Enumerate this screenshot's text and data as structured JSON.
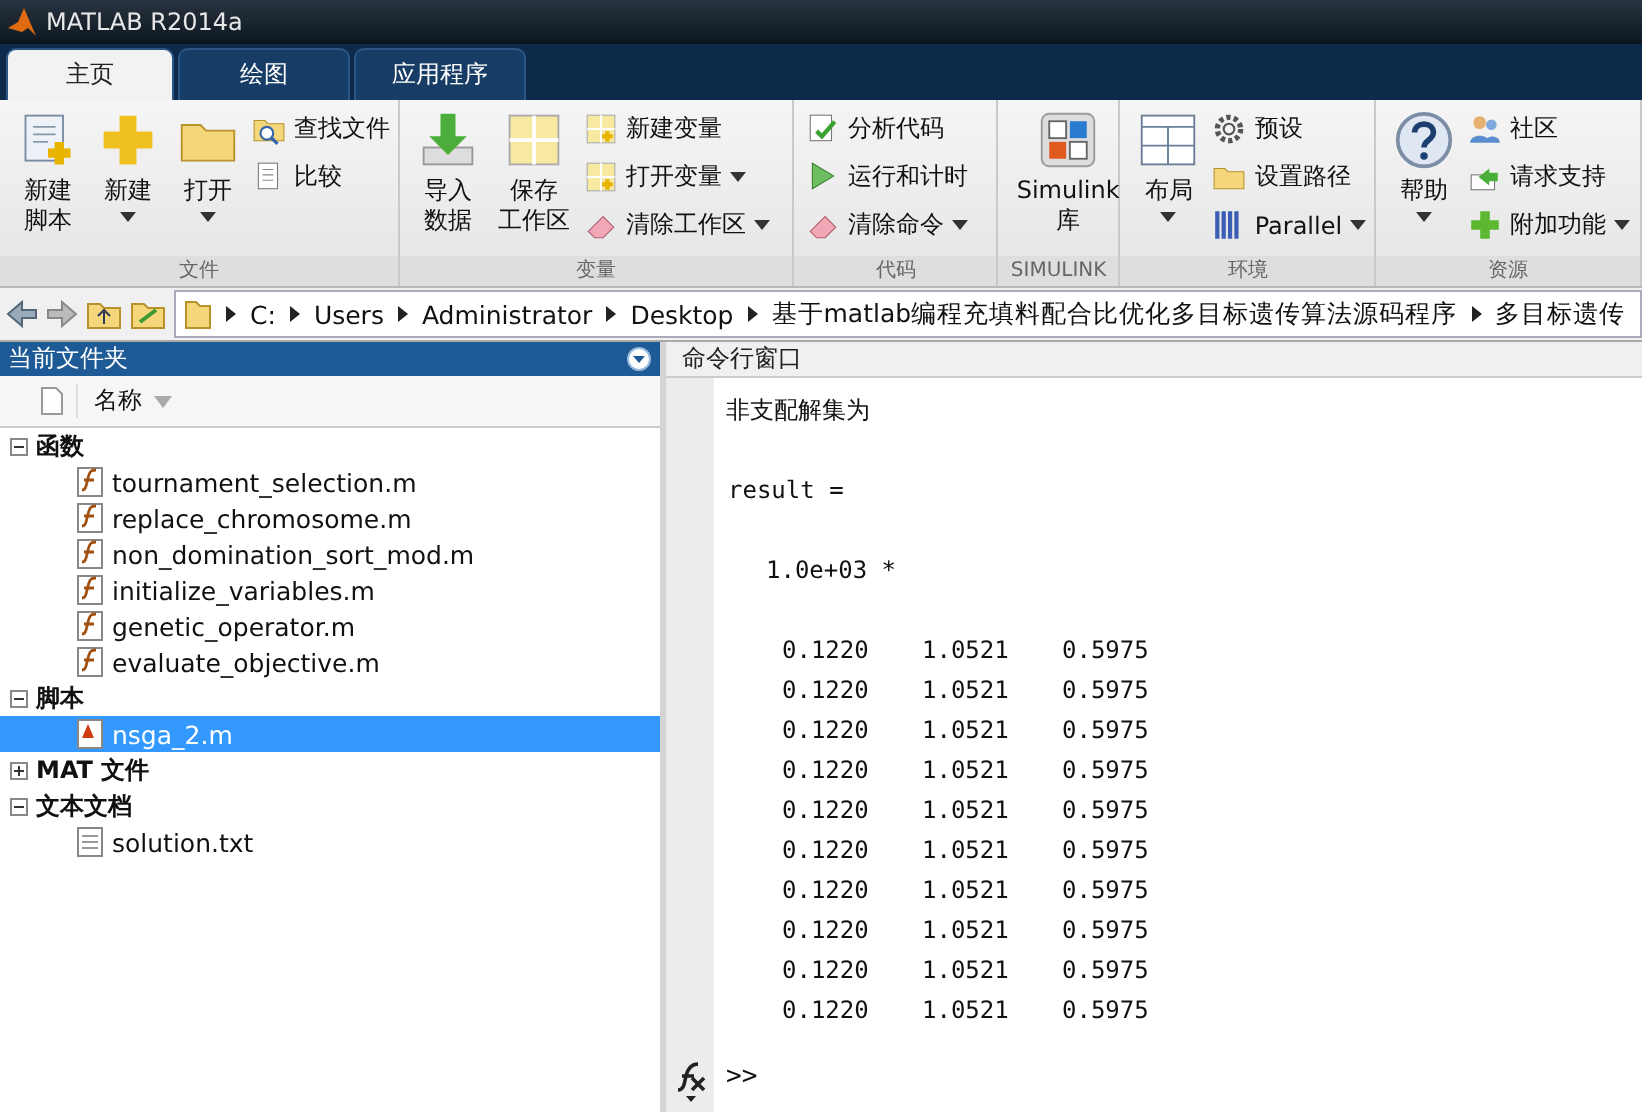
{
  "window": {
    "title": "MATLAB R2014a"
  },
  "tabs": [
    {
      "label": "主页",
      "selected": true
    },
    {
      "label": "绘图",
      "selected": false
    },
    {
      "label": "应用程序",
      "selected": false
    }
  ],
  "ribbon": [
    {
      "label": "文件",
      "items": [
        {
          "kind": "large",
          "lines": [
            "新建",
            "脚本"
          ],
          "dropdown": false
        },
        {
          "kind": "large",
          "lines": [
            "新建"
          ],
          "dropdown": true
        },
        {
          "kind": "large",
          "lines": [
            "打开"
          ],
          "dropdown": true
        },
        {
          "kind": "small",
          "lines": [
            "查找文件"
          ],
          "dropdown": false
        },
        {
          "kind": "small",
          "lines": [
            "比较"
          ],
          "dropdown": false
        }
      ]
    },
    {
      "label": "变量",
      "items": [
        {
          "kind": "large",
          "lines": [
            "导入",
            "数据"
          ],
          "dropdown": false
        },
        {
          "kind": "large",
          "lines": [
            "保存",
            "工作区"
          ],
          "dropdown": false
        },
        {
          "kind": "small",
          "lines": [
            "新建变量"
          ],
          "dropdown": false
        },
        {
          "kind": "small",
          "lines": [
            "打开变量"
          ],
          "dropdown": true
        },
        {
          "kind": "small",
          "lines": [
            "清除工作区"
          ],
          "dropdown": true
        }
      ]
    },
    {
      "label": "代码",
      "items": [
        {
          "kind": "small",
          "lines": [
            "分析代码"
          ],
          "dropdown": false
        },
        {
          "kind": "small",
          "lines": [
            "运行和计时"
          ],
          "dropdown": false
        },
        {
          "kind": "small",
          "lines": [
            "清除命令"
          ],
          "dropdown": true
        }
      ]
    },
    {
      "label": "SIMULINK",
      "items": [
        {
          "kind": "large",
          "lines": [
            "Simulink",
            "库"
          ],
          "dropdown": false
        }
      ]
    },
    {
      "label": "环境",
      "items": [
        {
          "kind": "large",
          "lines": [
            "布局"
          ],
          "dropdown": true
        },
        {
          "kind": "small",
          "lines": [
            "预设"
          ],
          "dropdown": false
        },
        {
          "kind": "small",
          "lines": [
            "设置路径"
          ],
          "dropdown": false
        },
        {
          "kind": "small",
          "lines": [
            "Parallel"
          ],
          "dropdown": true
        }
      ]
    },
    {
      "label": "资源",
      "items": [
        {
          "kind": "large",
          "lines": [
            "帮助"
          ],
          "dropdown": true
        },
        {
          "kind": "small",
          "lines": [
            "社区"
          ],
          "dropdown": false
        },
        {
          "kind": "small",
          "lines": [
            "请求支持"
          ],
          "dropdown": false
        },
        {
          "kind": "small",
          "lines": [
            "附加功能"
          ],
          "dropdown": true
        }
      ]
    }
  ],
  "address_bar": {
    "path": [
      "C:",
      "Users",
      "Administrator",
      "Desktop",
      "基于matlab编程充填料配合比优化多目标遗传算法源码程序",
      "多目标遗传"
    ]
  },
  "current_folder": {
    "title": "当前文件夹",
    "column": "名称",
    "groups": [
      {
        "label": "函数",
        "expanded": true,
        "children": [
          {
            "name": "tournament_selection.m",
            "kind": "function",
            "selected": false
          },
          {
            "name": "replace_chromosome.m",
            "kind": "function",
            "selected": false
          },
          {
            "name": "non_domination_sort_mod.m",
            "kind": "function",
            "selected": false
          },
          {
            "name": "initialize_variables.m",
            "kind": "function",
            "selected": false
          },
          {
            "name": "genetic_operator.m",
            "kind": "function",
            "selected": false
          },
          {
            "name": "evaluate_objective.m",
            "kind": "function",
            "selected": false
          }
        ]
      },
      {
        "label": "脚本",
        "expanded": true,
        "children": [
          {
            "name": "nsga_2.m",
            "kind": "script",
            "selected": true
          }
        ]
      },
      {
        "label": "MAT 文件",
        "expanded": false
      },
      {
        "label": "文本文档",
        "expanded": true,
        "children": [
          {
            "name": "solution.txt",
            "kind": "text",
            "selected": false
          }
        ]
      }
    ]
  },
  "command_window": {
    "title": "命令行窗口",
    "message": "非支配解集为",
    "variable": "result =",
    "scale": "1.0e+03 *",
    "rows": [
      [
        "0.1220",
        "1.0521",
        "0.5975"
      ],
      [
        "0.1220",
        "1.0521",
        "0.5975"
      ],
      [
        "0.1220",
        "1.0521",
        "0.5975"
      ],
      [
        "0.1220",
        "1.0521",
        "0.5975"
      ],
      [
        "0.1220",
        "1.0521",
        "0.5975"
      ],
      [
        "0.1220",
        "1.0521",
        "0.5975"
      ],
      [
        "0.1220",
        "1.0521",
        "0.5975"
      ],
      [
        "0.1220",
        "1.0521",
        "0.5975"
      ],
      [
        "0.1220",
        "1.0521",
        "0.5975"
      ],
      [
        "0.1220",
        "1.0521",
        "0.5975"
      ]
    ],
    "prompt": ">>"
  }
}
